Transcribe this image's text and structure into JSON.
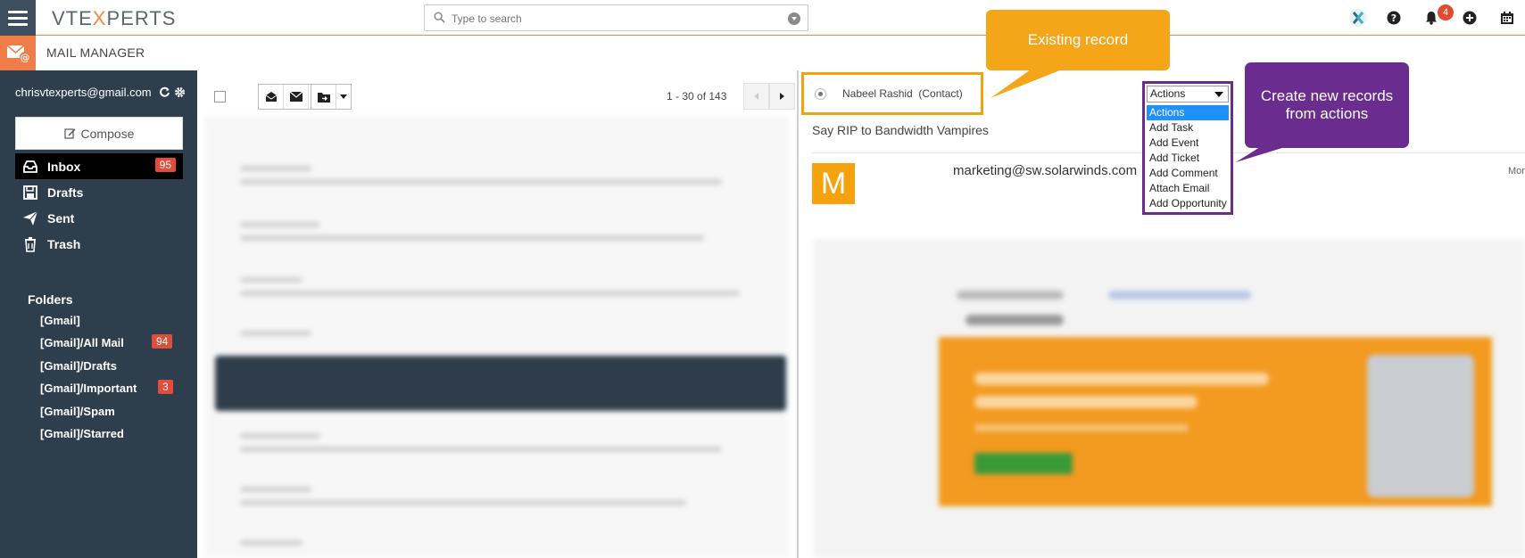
{
  "app": {
    "brand": "VTEXPERTS",
    "brand_accent_letter": "X",
    "module_title": "MAIL MANAGER",
    "accent_color": "#f08a3c"
  },
  "search": {
    "placeholder": "Type to search"
  },
  "topbar": {
    "notification_count": "4",
    "icons": [
      "logo-x-icon",
      "help-icon",
      "bell-icon",
      "plus-circle-icon",
      "calendar-icon"
    ]
  },
  "sidebar": {
    "account": "chrisvtexperts@gmail.com",
    "compose_label": "Compose",
    "nav": [
      {
        "label": "Inbox",
        "badge": "95",
        "icon": "inbox-icon"
      },
      {
        "label": "Drafts",
        "badge": "",
        "icon": "save-icon"
      },
      {
        "label": "Sent",
        "badge": "",
        "icon": "send-icon"
      },
      {
        "label": "Trash",
        "badge": "",
        "icon": "trash-icon"
      }
    ],
    "folders_heading": "Folders",
    "folders": [
      {
        "label": "[Gmail]",
        "badge": ""
      },
      {
        "label": "[Gmail]/All Mail",
        "badge": "94"
      },
      {
        "label": "[Gmail]/Drafts",
        "badge": ""
      },
      {
        "label": "[Gmail]/Important",
        "badge": "3"
      },
      {
        "label": "[Gmail]/Spam",
        "badge": ""
      },
      {
        "label": "[Gmail]/Starred",
        "badge": ""
      }
    ]
  },
  "list": {
    "pager": "1 - 30 of 143"
  },
  "detail": {
    "record": "Nabeel Rashid  (Contact)",
    "subject": "Say RIP to Bandwidth Vampires",
    "avatar_letter": "M",
    "sender": "marketing@sw.solarwinds.com",
    "date_fragment": "Mor"
  },
  "actions": {
    "selected": "Actions",
    "options": [
      "Actions",
      "Add Task",
      "Add Event",
      "Add Ticket",
      "Add Comment",
      "Attach Email",
      "Add Opportunity"
    ]
  },
  "callouts": {
    "existing": "Existing record",
    "create_line1": "Create new records",
    "create_line2": "from actions"
  }
}
